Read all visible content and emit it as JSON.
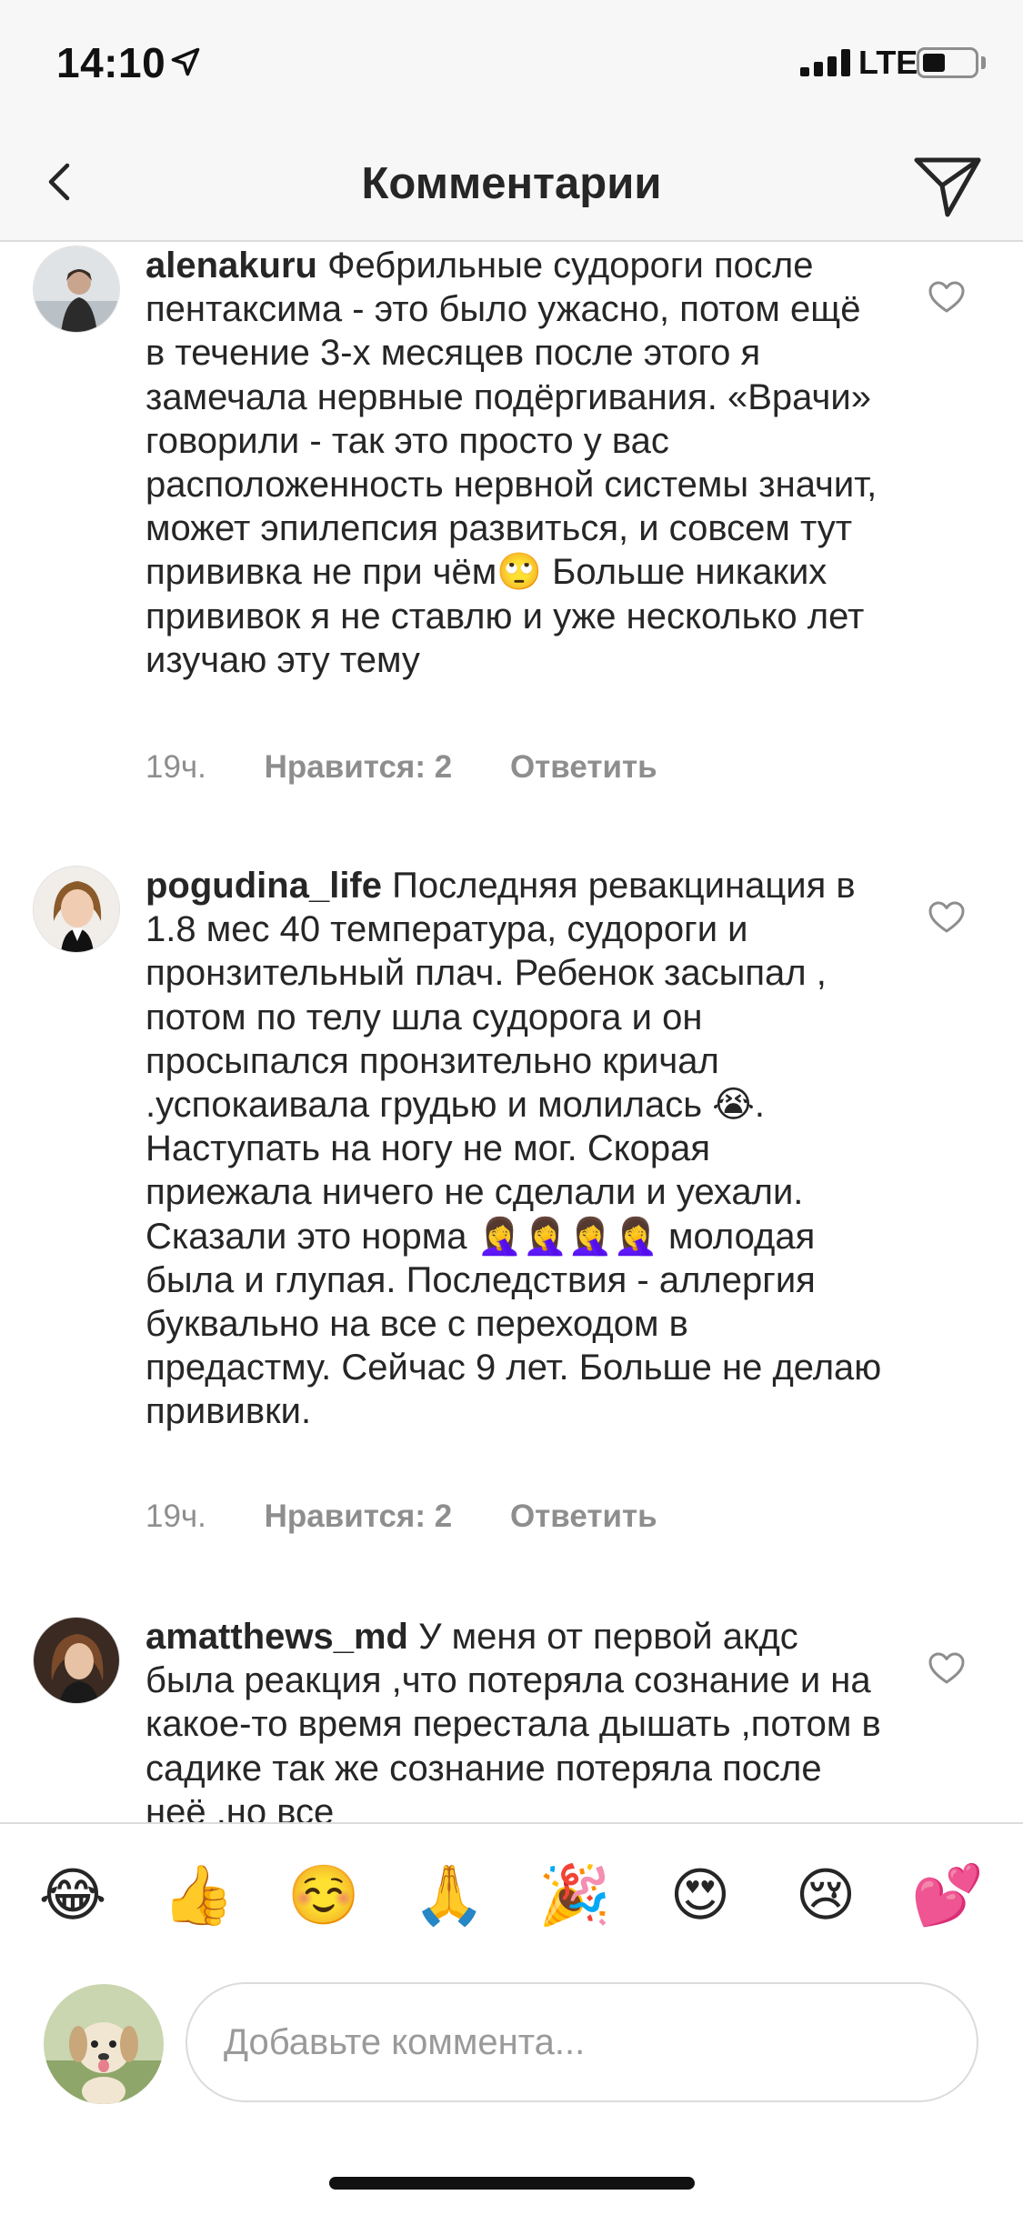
{
  "status_bar": {
    "time": "14:10",
    "network": "LTE"
  },
  "header": {
    "title": "Комментарии"
  },
  "comments": [
    {
      "username": "alenakuru",
      "text": "Фебрильные судороги после пентаксима - это было ужасно, потом ещё в течение 3-х месяцев после этого я замечала нервные подёргивания. «Врачи» говорили - так это просто у вас расположенность нервной системы значит, может эпилепсия развиться, и совсем тут прививка не при чём🙄 Больше никаких прививок я не ставлю и уже несколько лет изучаю эту тему",
      "time": "19ч.",
      "likes": "Нравится: 2",
      "reply": "Ответить"
    },
    {
      "username": "pogudina_life",
      "text": "Последняя ревакцинация в 1.8 мес 40 температура, судороги и пронзительный плач. Ребенок засыпал , потом по телу шла судорога и он просыпался пронзительно кричал .успокаивала грудью и молилась 😭. Наступать на ногу не мог.  Скорая приежала ничего не сделали и уехали. Сказали это норма 🤦‍♀️🤦‍♀️🤦‍♀️🤦‍♀️ молодая была и глупая. Последствия - аллергия буквально на все с переходом в предастму. Сейчас 9 лет. Больше не делаю прививки.",
      "time": "19ч.",
      "likes": "Нравится: 2",
      "reply": "Ответить"
    },
    {
      "username": "amatthews_md",
      "text": "У меня от первой акдс была реакция ,что потеряла сознание и на какое-то время перестала дышать ,потом в садике так же сознание потеряла после неё ,но все",
      "time": "",
      "likes": "",
      "reply": ""
    }
  ],
  "emoji_bar": [
    "😂",
    "👍",
    "☺️",
    "🙏",
    "🎉",
    "😍",
    "😢",
    "💕"
  ],
  "comment_input": {
    "placeholder": "Добавьте коммента..."
  },
  "colors": {
    "text": "#262626",
    "secondary": "#8e8e8e",
    "bar_background": "#f7f7f7",
    "border": "#dbdbdb"
  },
  "icons": [
    "location-arrow-icon",
    "signal-icon",
    "battery-icon",
    "back-chevron-icon",
    "direct-send-icon",
    "heart-icon"
  ]
}
